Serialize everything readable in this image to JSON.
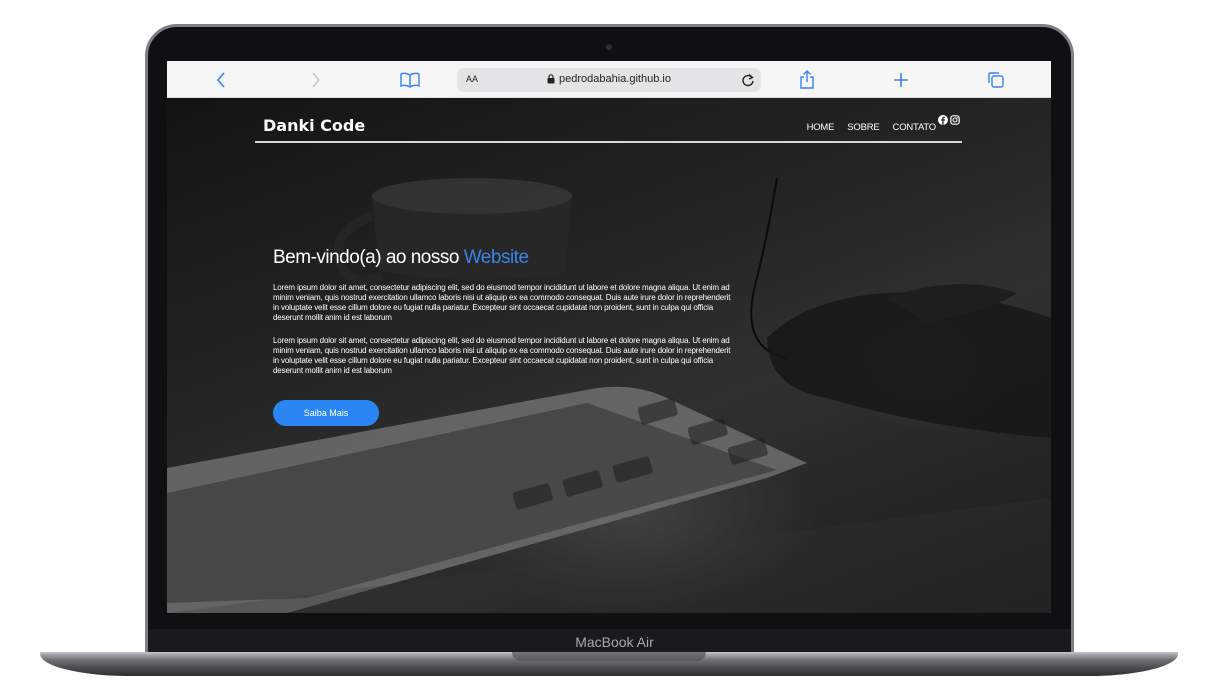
{
  "device": {
    "label": "MacBook Air"
  },
  "browser": {
    "url": "pedrodabahia.github.io",
    "text_size_label": "AA",
    "toolbar_icons": [
      "back-icon",
      "forward-icon",
      "bookmarks-icon",
      "share-icon",
      "new-tab-icon",
      "tabs-icon"
    ],
    "accent_color": "#1a73e8"
  },
  "site": {
    "brand": "Danki Code",
    "nav": [
      "HOME",
      "SOBRE",
      "CONTATO"
    ],
    "social_icons": [
      "facebook-icon",
      "instagram-icon"
    ],
    "hero": {
      "title_start": "Bem-vindo(a) ao nosso ",
      "title_accent": "Website",
      "paragraphs": [
        "Lorem ipsum dolor sit amet, consectetur adipiscing elit, sed do eiusmod tempor incididunt ut labore et dolore magna aliqua. Ut enim ad minim veniam, quis nostrud exercitation ullamco laboris nisi ut aliquip ex ea commodo consequat. Duis aute irure dolor in reprehenderit in voluptate velit esse cillum dolore eu fugiat nulla pariatur. Excepteur sint occaecat cupidatat non proident, sunt in culpa qui officia deserunt mollit anim id est laborum",
        "Lorem ipsum dolor sit amet, consectetur adipiscing elit, sed do eiusmod tempor incididunt ut labore et dolore magna aliqua. Ut enim ad minim veniam, quis nostrud exercitation ullamco laboris nisi ut aliquip ex ea commodo consequat. Duis aute irure dolor in reprehenderit in voluptate velit esse cillum dolore eu fugiat nulla pariatur. Excepteur sint occaecat cupidatat non proident, sunt in culpa qui officia deserunt mollit anim id est laborum"
      ],
      "button_label": "Saiba Mais"
    },
    "colors": {
      "accent": "#3a84e8",
      "button": "#2a86f5"
    }
  }
}
